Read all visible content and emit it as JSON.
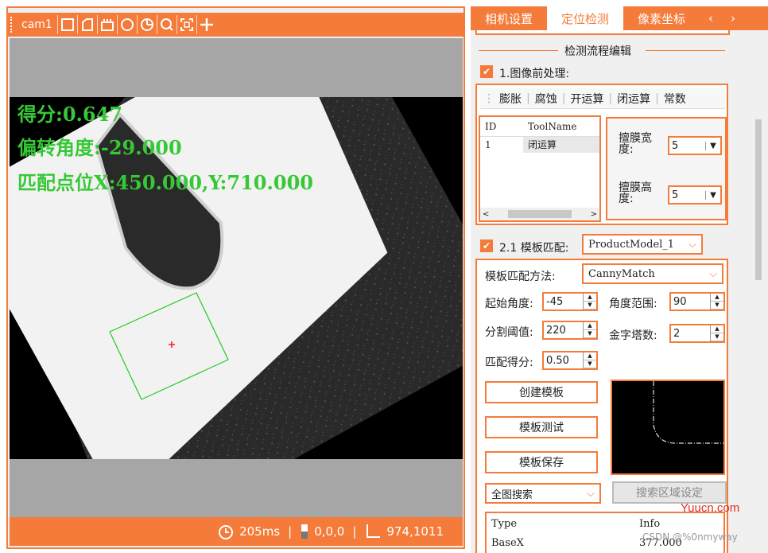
{
  "camera": {
    "name": "cam1",
    "toolbar_icons": [
      "rect-icon",
      "polygon-icon",
      "mask-icon",
      "circle-icon",
      "pie-icon",
      "zoom-icon",
      "fit-icon",
      "crosshair-icon"
    ],
    "overlay": {
      "score": "得分:0.647",
      "angle": "偏转角度:-29.000",
      "position": "匹配点位X:450.000,Y:710.000"
    },
    "status": {
      "time": "205ms",
      "gray": "0,0,0",
      "coords": "974,1011"
    }
  },
  "tabs": {
    "camera_settings": "相机设置",
    "locate_detect": "定位检测",
    "pixel_coords": "像素坐标"
  },
  "flow_title": "检测流程编辑",
  "preprocess": {
    "label": "1.图像前处理:",
    "checked": true,
    "ops": [
      "膨胀",
      "腐蚀",
      "开运算",
      "闭运算",
      "常数"
    ],
    "table": {
      "headers": [
        "ID",
        "ToolName"
      ],
      "rows": [
        [
          "1",
          "闭运算"
        ]
      ]
    },
    "kernel_width_label": "擅膜宽度:",
    "kernel_width": "5",
    "kernel_height_label": "擅膜高度:",
    "kernel_height": "5"
  },
  "match": {
    "label": "2.1 模板匹配:",
    "checked": true,
    "model": "ProductModel_1",
    "method_label": "模板匹配方法:",
    "method": "CannyMatch",
    "start_angle_label": "起始角度:",
    "start_angle": "-45",
    "angle_range_label": "角度范围:",
    "angle_range": "90",
    "threshold_label": "分割阈值:",
    "threshold": "220",
    "pyramid_label": "金字塔数:",
    "pyramid": "2",
    "score_label": "匹配得分:",
    "score": "0.50",
    "create_btn": "创建模板",
    "test_btn": "模板测试",
    "save_btn": "模板保存",
    "search_mode": "全图搜索",
    "search_area_btn": "搜索区域设定"
  },
  "result_table": {
    "headers": [
      "Type",
      "Info"
    ],
    "rows": [
      [
        "BaseX",
        "377.000"
      ]
    ]
  },
  "watermark": {
    "site": "Yuucn.com",
    "csdn": "CSDN @%0nmyway"
  },
  "colors": {
    "accent": "#f47b3a",
    "overlay_text": "#37c837"
  }
}
